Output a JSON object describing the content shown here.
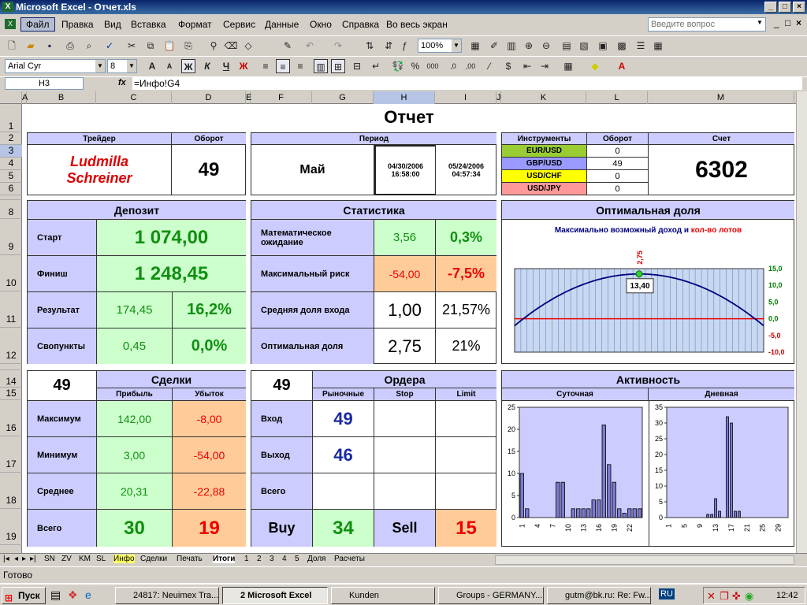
{
  "window": {
    "title": "Microsoft Excel - Отчет.xls",
    "win_min": "_",
    "win_max": "□",
    "win_close": "×"
  },
  "menu": {
    "items": [
      "Файл",
      "Правка",
      "Вид",
      "Вставка",
      "Формат",
      "Сервис",
      "Данные",
      "Окно",
      "Справка",
      "Во весь экран"
    ],
    "help_placeholder": "Введите вопрос",
    "doc_min": "_",
    "doc_max": "□",
    "doc_close": "×"
  },
  "toolbar1": {
    "zoom": "100%"
  },
  "toolbar2": {
    "font": "Arial Cyr",
    "size": "8",
    "bold": "Ж",
    "italic": "К",
    "underline": "Ч"
  },
  "formula_bar": {
    "cell_ref": "H3",
    "fx": "fx",
    "formula": "=Инфо!G4"
  },
  "columns": [
    "A",
    "B",
    "C",
    "D",
    "E",
    "F",
    "G",
    "H",
    "I",
    "J",
    "K",
    "L",
    "M"
  ],
  "rows": [
    "1",
    "2",
    "3",
    "4",
    "5",
    "6",
    "7",
    "8",
    "9",
    "10",
    "11",
    "12",
    "13",
    "14",
    "15",
    "16",
    "17",
    "18",
    "19"
  ],
  "report": {
    "title": "Отчет",
    "trader": {
      "header": "Трейдер",
      "name_line1": "Ludmilla",
      "name_line2": "Schreiner",
      "turnover_header": "Оборот",
      "turnover": "49"
    },
    "period": {
      "header": "Период",
      "month": "Май",
      "start_date": "04/30/2006",
      "start_time": "16:58:00",
      "end_date": "05/24/2006",
      "end_time": "04:57:34"
    },
    "instruments": {
      "header": "Инструменты",
      "turnover_header": "Оборот",
      "items": [
        {
          "name": "EUR/USD",
          "value": "0",
          "color": "#99cc33"
        },
        {
          "name": "GBP/USD",
          "value": "49",
          "color": "#9999ff"
        },
        {
          "name": "USD/CHF",
          "value": "0",
          "color": "#ffff00"
        },
        {
          "name": "USD/JPY",
          "value": "0",
          "color": "#ff9999"
        }
      ]
    },
    "account": {
      "header": "Счет",
      "value": "6302"
    },
    "deposit": {
      "header": "Депозит",
      "start_label": "Старт",
      "start": "1 074,00",
      "finish_label": "Финиш",
      "finish": "1 248,45",
      "result_label": "Результат",
      "result": "174,45",
      "result_pct": "16,2%",
      "swap_label": "Свопункты",
      "swap": "0,45",
      "swap_pct": "0,0%"
    },
    "stats": {
      "header": "Статистика",
      "rows": [
        {
          "label": "Математическое ожидание",
          "v1": "3,56",
          "v2": "0,3%"
        },
        {
          "label": "Максимальный риск",
          "v1": "-54,00",
          "v2": "-7,5%"
        },
        {
          "label": "Средняя доля входа",
          "v1": "1,00",
          "v2": "21,57%"
        },
        {
          "label": "Оптимальная доля",
          "v1": "2,75",
          "v2": "21%"
        }
      ]
    },
    "optimal": {
      "header": "Оптимальная доля",
      "subtitle_a": "Максимально возможный доход и ",
      "subtitle_b": "кол-во лотов",
      "peak_label": "2,75",
      "peak_value": "13,40"
    },
    "deals": {
      "count": "49",
      "header": "Сделки",
      "profit_header": "Прибыль",
      "loss_header": "Убыток",
      "rows": [
        {
          "label": "Максимум",
          "profit": "142,00",
          "loss": "-8,00"
        },
        {
          "label": "Минимум",
          "profit": "3,00",
          "loss": "-54,00"
        },
        {
          "label": "Среднее",
          "profit": "20,31",
          "loss": "-22,88"
        },
        {
          "label": "Всего",
          "profit": "30",
          "loss": "19"
        }
      ]
    },
    "orders": {
      "count": "49",
      "header": "Ордера",
      "market_header": "Рыночные",
      "stop_header": "Stop",
      "limit_header": "Limit",
      "entry_label": "Вход",
      "entry": "49",
      "exit_label": "Выход",
      "exit": "46",
      "total_label": "Всего",
      "buy_label": "Buy",
      "buy": "34",
      "sell_label": "Sell",
      "sell": "15"
    },
    "activity": {
      "header": "Активность",
      "daily": "Суточная",
      "weekly": "Дневная"
    }
  },
  "chart_data": [
    {
      "type": "line",
      "title": "Максимально возможный доход и кол-во лотов",
      "x": [
        0,
        0.5,
        1,
        1.5,
        2,
        2.5,
        2.75,
        3,
        3.5,
        4,
        4.5,
        5,
        5.5
      ],
      "y": [
        0,
        5.2,
        8.9,
        11.6,
        13.0,
        13.35,
        13.4,
        13.3,
        12.2,
        9.8,
        6.2,
        1.6,
        -4.0
      ],
      "ylim": [
        -10,
        15
      ],
      "yticks": [
        "15,0",
        "10,0",
        "5,0",
        "0,0",
        "-5,0",
        "-10,0"
      ],
      "annotation_x": "2,75",
      "annotation_y": "13,40"
    },
    {
      "type": "bar",
      "title": "Суточная",
      "categories": [
        "1",
        "2",
        "3",
        "4",
        "5",
        "6",
        "7",
        "8",
        "9",
        "10",
        "11",
        "12",
        "13",
        "14",
        "15",
        "16",
        "17",
        "18",
        "19",
        "20",
        "21",
        "22",
        "23",
        "24"
      ],
      "values": [
        10,
        2,
        0,
        0,
        0,
        0,
        0,
        8,
        8,
        0,
        2,
        2,
        2,
        2,
        4,
        4,
        21,
        12,
        8,
        2,
        1,
        2,
        2,
        2
      ],
      "ylim": [
        0,
        25
      ],
      "yticks": [
        "25",
        "20",
        "15",
        "10",
        "5",
        "0"
      ],
      "xticks": [
        "1",
        "4",
        "7",
        "10",
        "13",
        "16",
        "19",
        "22"
      ]
    },
    {
      "type": "bar",
      "title": "Дневная",
      "categories": [
        "1",
        "2",
        "3",
        "4",
        "5",
        "6",
        "7",
        "8",
        "9",
        "10",
        "11",
        "12",
        "13",
        "14",
        "15",
        "16",
        "17",
        "18",
        "19",
        "20",
        "21",
        "22",
        "23",
        "24",
        "25",
        "26",
        "27",
        "28",
        "29",
        "30",
        "31"
      ],
      "values": [
        0,
        0,
        0,
        0,
        0,
        0,
        0,
        0,
        0,
        0,
        1,
        1,
        6,
        2,
        0,
        32,
        30,
        2,
        2,
        0,
        0,
        0,
        0,
        0,
        0,
        0,
        0,
        0,
        0,
        0,
        0
      ],
      "ylim": [
        0,
        35
      ],
      "yticks": [
        "35",
        "30",
        "25",
        "20",
        "15",
        "10",
        "5",
        "0"
      ],
      "xticks": [
        "1",
        "5",
        "9",
        "13",
        "17",
        "21",
        "25",
        "29"
      ]
    }
  ],
  "sheet_tabs": [
    "SN",
    "ZV",
    "KM",
    "SL",
    "Инфо",
    "Сделки",
    "Печать",
    "Итоги",
    "1",
    "2",
    "3",
    "4",
    "5",
    "Доля",
    "Расчеты"
  ],
  "status": "Готово",
  "taskbar": {
    "start": "Пуск",
    "items": [
      "24817: Neuimex Tra...",
      "2 Microsoft Excel",
      "Kunden",
      "Groups - GERMANY...",
      "gutm@bk.ru: Re: Fw..."
    ],
    "lang": "RU",
    "clock": "12:42"
  }
}
